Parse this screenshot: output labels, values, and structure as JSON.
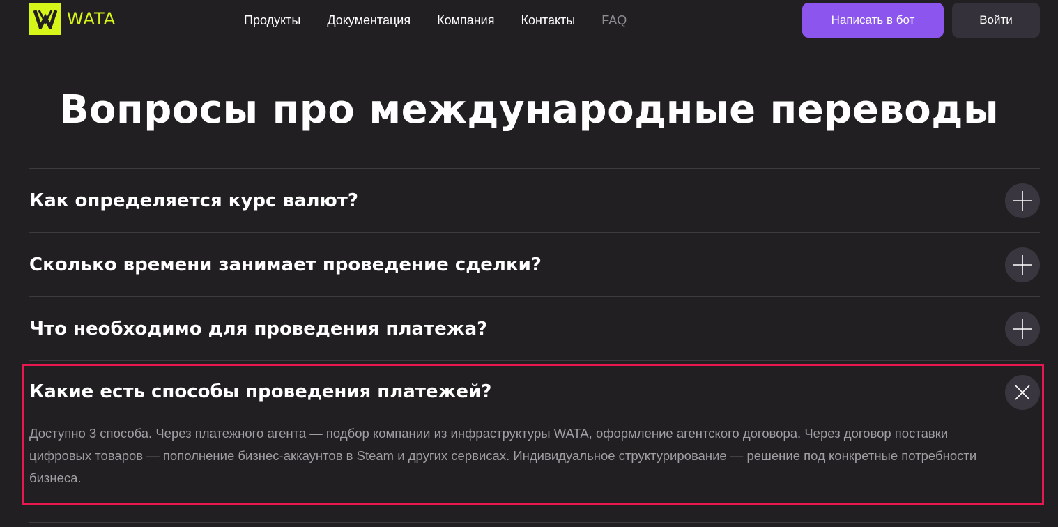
{
  "header": {
    "logo_text": "WATA",
    "nav": [
      {
        "label": "Продукты"
      },
      {
        "label": "Документация"
      },
      {
        "label": "Компания"
      },
      {
        "label": "Контакты"
      },
      {
        "label": "FAQ"
      }
    ],
    "bot_button": "Написать в бот",
    "login_button": "Войти"
  },
  "colors": {
    "background": "#221f22",
    "brand": "#d6f518",
    "accent": "#8c55ee",
    "highlight": "#e8174f"
  },
  "title": "Вопросы про международные переводы",
  "faq": [
    {
      "question": "Как определяется курс валют?",
      "icon": "plus-icon"
    },
    {
      "question": "Сколько времени занимает проведение сделки?",
      "icon": "plus-icon"
    },
    {
      "question": "Что необходимо для проведения платежа?",
      "icon": "plus-icon"
    },
    {
      "question": "Какие есть способы проведения платежей?",
      "icon": "close-icon",
      "answer": "Доступно 3 способа. Через платежного агента — подбор компании из инфраструктуры WATA, оформление агентского договора. Через договор поставки цифровых товаров — пополнение бизнес-аккаунтов в Steam и других сервисах. Индивидуальное структурирование — решение под конкретные потребности бизнеса."
    }
  ]
}
